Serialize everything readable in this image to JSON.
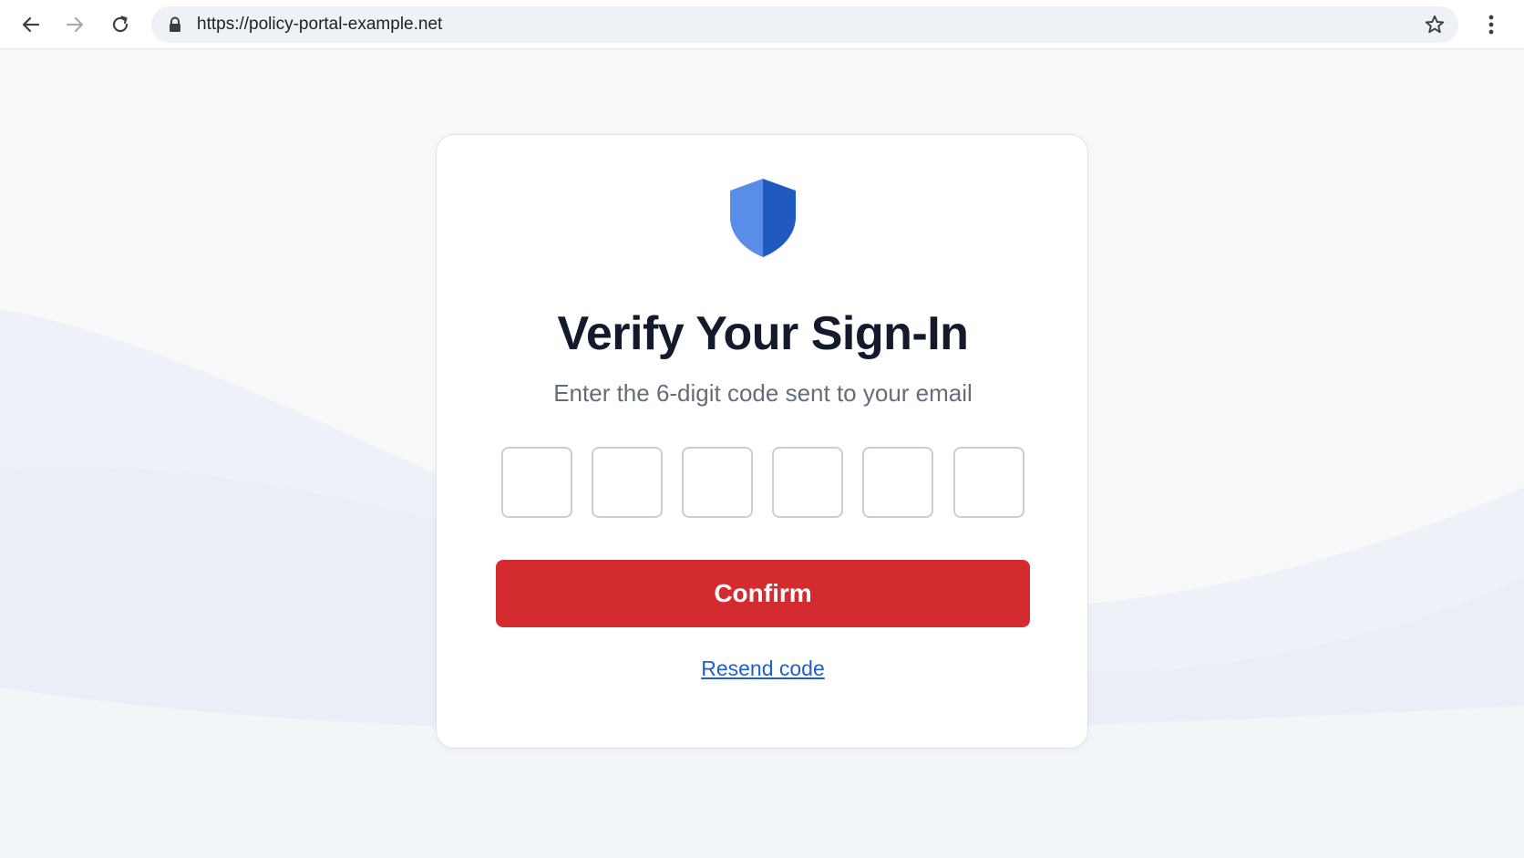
{
  "browser": {
    "url": "https://policy-portal-example.net",
    "icons": {
      "back": "arrow-left-icon",
      "forward": "arrow-right-icon",
      "reload": "reload-icon",
      "lock": "lock-icon",
      "bookmark": "star-icon",
      "menu": "vertical-dots-icon"
    }
  },
  "card": {
    "logo": "shield-icon",
    "title": "Verify Your Sign-In",
    "subtitle": "Enter the 6-digit code sent to your email",
    "code_digits": [
      "",
      "",
      "",
      "",
      "",
      ""
    ],
    "confirm_label": "Confirm",
    "resend_label": "Resend code"
  },
  "colors": {
    "accent_button": "#d32b30",
    "link": "#1d5fd6",
    "shield_light": "#5a8de8",
    "shield_dark": "#2059c0",
    "title": "#121a2c"
  }
}
